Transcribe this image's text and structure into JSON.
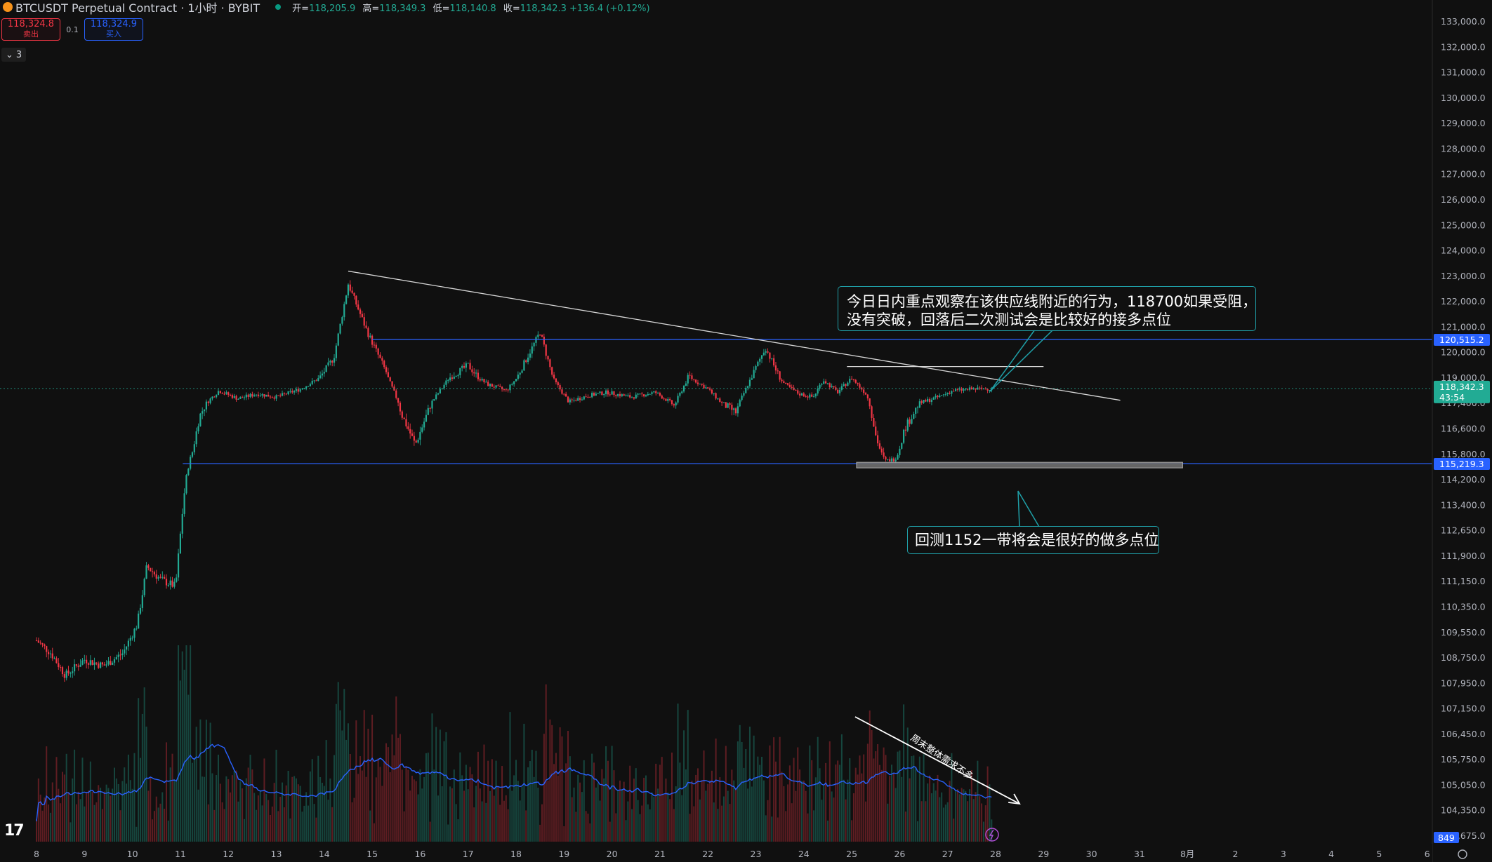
{
  "header": {
    "symbol_title": "BTCUSDT Perpetual Contract · 1小时 · BYBIT",
    "ohlc": [
      {
        "label": "开=",
        "value": "118,205.9"
      },
      {
        "label": "高=",
        "value": "118,349.3"
      },
      {
        "label": "低=",
        "value": "118,140.8"
      },
      {
        "label": "收=",
        "value": "118,342.3 +136.4 (+0.12%)"
      }
    ]
  },
  "trade": {
    "sell_price": "118,324.8",
    "sell_label": "卖出",
    "spread": "0.1",
    "buy_price": "118,324.9",
    "buy_label": "买入"
  },
  "indicators_toggle": {
    "count": "3"
  },
  "annotations": {
    "top_callout_line1": "今日日内重点观察在该供应线附近的行为，118700如果受阻，",
    "top_callout_line2": "没有突破，回落后二次测试会是比较好的接多点位",
    "bottom_callout": "回测1152一带将会是很好的做多点位",
    "arrow_note": "周末整体需求不多"
  },
  "price_labels": {
    "resistance": "120,515.2",
    "current": "118,342.3",
    "countdown": "43:54",
    "support": "115,219.3",
    "volume": "849"
  },
  "colors": {
    "up": "#22ab94",
    "down": "#f23645",
    "level_line": "#2962ff",
    "callout_border": "#1fa0a8",
    "volume_ma": "#2962ff",
    "current_price_bg": "#22ab94"
  },
  "chart_data": {
    "type": "candlestick",
    "symbol": "BTCUSDT",
    "interval": "1H",
    "exchange": "BYBIT",
    "y_axis": {
      "ticks": [
        "133,000.0",
        "132,000.0",
        "131,000.0",
        "130,000.0",
        "129,000.0",
        "128,000.0",
        "127,000.0",
        "126,000.0",
        "125,000.0",
        "124,000.0",
        "123,000.0",
        "122,000.0",
        "121,000.0",
        "120,000.0",
        "119,000.0",
        "117,400.0",
        "116,600.0",
        "115,800.0",
        "114,200.0",
        "113,400.0",
        "112,650.0",
        "111,900.0",
        "111,150.0",
        "110,350.0",
        "109,550.0",
        "108,750.0",
        "107,950.0",
        "107,150.0",
        "106,450.0",
        "105,750.0",
        "105,050.0",
        "104,350.0",
        "103,675.0"
      ],
      "ylim": [
        103675,
        133000
      ]
    },
    "x_axis": {
      "ticks": [
        "8",
        "9",
        "10",
        "11",
        "12",
        "13",
        "14",
        "15",
        "16",
        "17",
        "18",
        "19",
        "20",
        "21",
        "22",
        "23",
        "24",
        "25",
        "26",
        "27",
        "28",
        "29",
        "30",
        "31",
        "8月",
        "2",
        "3",
        "4",
        "5",
        "6"
      ]
    },
    "price_path": [
      {
        "day": 8.0,
        "close": 109300
      },
      {
        "day": 8.3,
        "close": 108900
      },
      {
        "day": 8.6,
        "close": 108200
      },
      {
        "day": 9.0,
        "close": 108700
      },
      {
        "day": 9.4,
        "close": 108500
      },
      {
        "day": 9.8,
        "close": 108900
      },
      {
        "day": 10.1,
        "close": 109800
      },
      {
        "day": 10.3,
        "close": 111600
      },
      {
        "day": 10.6,
        "close": 111200
      },
      {
        "day": 10.9,
        "close": 111000
      },
      {
        "day": 11.05,
        "close": 113300
      },
      {
        "day": 11.2,
        "close": 115500
      },
      {
        "day": 11.4,
        "close": 117000
      },
      {
        "day": 11.8,
        "close": 118200
      },
      {
        "day": 12.2,
        "close": 117700
      },
      {
        "day": 12.6,
        "close": 118000
      },
      {
        "day": 13.0,
        "close": 117800
      },
      {
        "day": 13.5,
        "close": 118300
      },
      {
        "day": 13.9,
        "close": 119000
      },
      {
        "day": 14.2,
        "close": 119800
      },
      {
        "day": 14.5,
        "close": 122700
      },
      {
        "day": 14.9,
        "close": 120800
      },
      {
        "day": 15.3,
        "close": 119200
      },
      {
        "day": 15.6,
        "close": 117100
      },
      {
        "day": 15.9,
        "close": 116100
      },
      {
        "day": 16.2,
        "close": 117300
      },
      {
        "day": 16.6,
        "close": 119000
      },
      {
        "day": 17.0,
        "close": 119500
      },
      {
        "day": 17.4,
        "close": 118600
      },
      {
        "day": 17.8,
        "close": 118200
      },
      {
        "day": 18.2,
        "close": 119700
      },
      {
        "day": 18.5,
        "close": 120800
      },
      {
        "day": 18.8,
        "close": 118800
      },
      {
        "day": 19.1,
        "close": 117500
      },
      {
        "day": 19.5,
        "close": 117900
      },
      {
        "day": 19.9,
        "close": 118100
      },
      {
        "day": 20.4,
        "close": 117800
      },
      {
        "day": 20.9,
        "close": 118100
      },
      {
        "day": 21.3,
        "close": 117300
      },
      {
        "day": 21.6,
        "close": 119100
      },
      {
        "day": 22.0,
        "close": 118300
      },
      {
        "day": 22.3,
        "close": 117400
      },
      {
        "day": 22.6,
        "close": 117100
      },
      {
        "day": 22.9,
        "close": 119000
      },
      {
        "day": 23.2,
        "close": 120200
      },
      {
        "day": 23.6,
        "close": 118600
      },
      {
        "day": 23.9,
        "close": 118000
      },
      {
        "day": 24.2,
        "close": 117800
      },
      {
        "day": 24.4,
        "close": 118900
      },
      {
        "day": 24.7,
        "close": 118100
      },
      {
        "day": 25.0,
        "close": 119000
      },
      {
        "day": 25.3,
        "close": 118000
      },
      {
        "day": 25.5,
        "close": 116400
      },
      {
        "day": 25.7,
        "close": 115400
      },
      {
        "day": 25.9,
        "close": 115500
      },
      {
        "day": 26.1,
        "close": 116600
      },
      {
        "day": 26.4,
        "close": 117400
      },
      {
        "day": 26.8,
        "close": 117800
      },
      {
        "day": 27.1,
        "close": 118200
      },
      {
        "day": 27.5,
        "close": 118300
      },
      {
        "day": 27.95,
        "close": 118342
      }
    ],
    "levels": [
      {
        "name": "resistance",
        "price": 120515.2
      },
      {
        "name": "support",
        "price": 115219.3
      }
    ],
    "trendline": {
      "from": {
        "day": 14.5,
        "price": 123200
      },
      "to": {
        "day": 30.6,
        "price": 117600
      }
    },
    "supply_ray": {
      "from": {
        "day": 24.9,
        "price": 119450
      },
      "to": {
        "day": 29.0,
        "price": 119450
      }
    },
    "support_zone": {
      "from_day": 25.1,
      "to_day": 31.9,
      "top": 115300,
      "bottom": 115050
    },
    "arrow": {
      "from_day": 25.1,
      "to_day": 28.5
    }
  }
}
